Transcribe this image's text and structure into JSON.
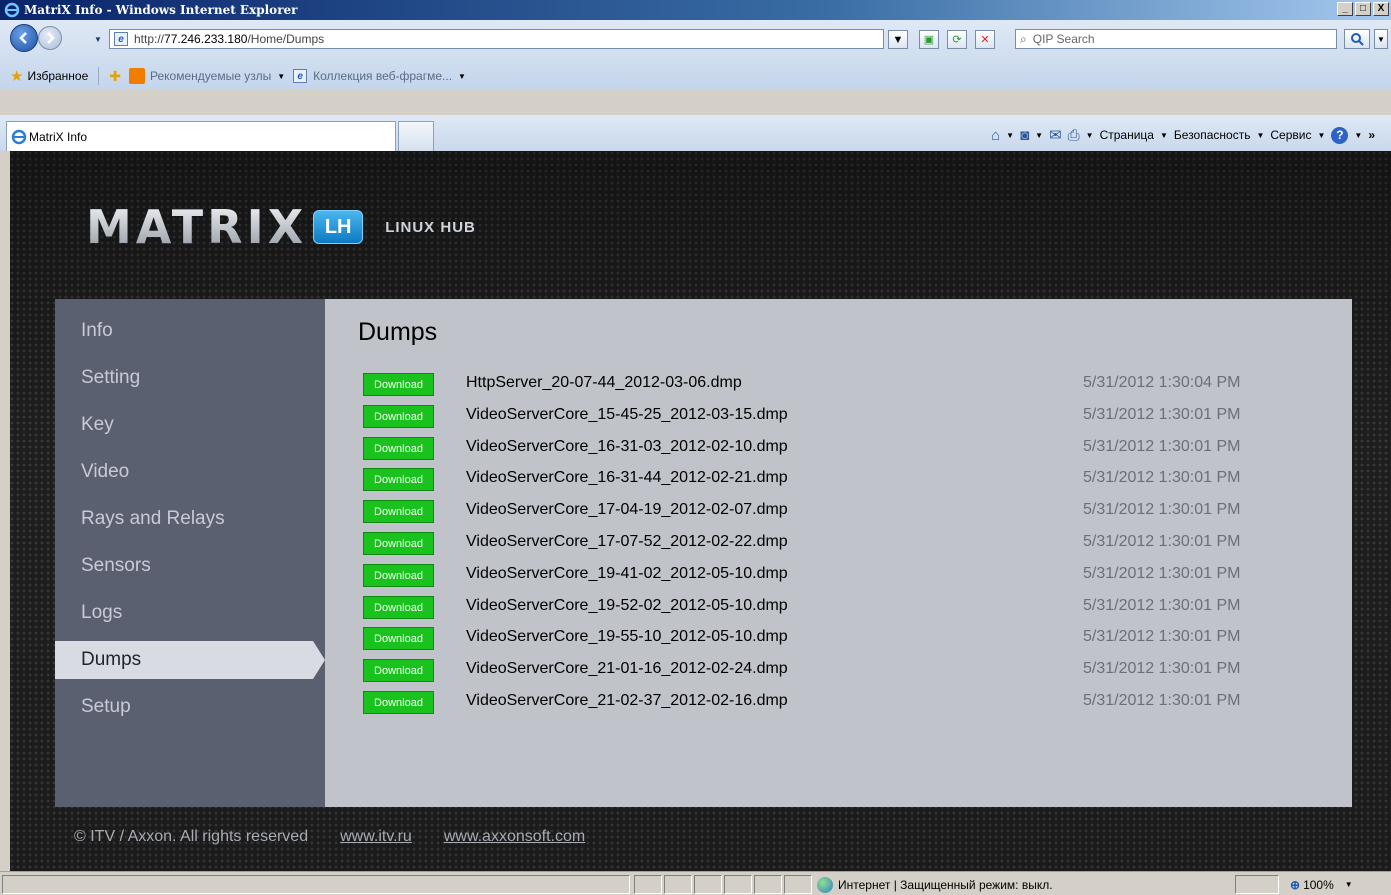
{
  "window": {
    "title": "MatriX Info - Windows Internet Explorer",
    "minimize": "_",
    "maximize": "□",
    "close": "X"
  },
  "address": {
    "url_prefix": "http://",
    "url_host": "77.246.233.180",
    "url_path": "/Home/Dumps",
    "search_placeholder": "QIP Search"
  },
  "favorites": {
    "label": "Избранное",
    "recommended": "Рекомендуемые узлы",
    "collection": "Коллекция веб-фрагме..."
  },
  "tab": {
    "title": "MatriX Info"
  },
  "commandbar": {
    "page": "Страница",
    "safety": "Безопасность",
    "tools": "Сервис",
    "more": "»"
  },
  "brand": {
    "word": "MATRIX",
    "badge": "LH",
    "subtitle": "LINUX HUB"
  },
  "nav": {
    "items": [
      {
        "label": "Info"
      },
      {
        "label": "Setting"
      },
      {
        "label": "Key"
      },
      {
        "label": "Video"
      },
      {
        "label": "Rays and Relays"
      },
      {
        "label": "Sensors"
      },
      {
        "label": "Logs"
      },
      {
        "label": "Dumps"
      },
      {
        "label": "Setup"
      }
    ],
    "active": "Dumps"
  },
  "page": {
    "title": "Dumps",
    "download_label": "Download",
    "files": [
      {
        "name": "HttpServer_20-07-44_2012-03-06.dmp",
        "date": "5/31/2012 1:30:04 PM"
      },
      {
        "name": "VideoServerCore_15-45-25_2012-03-15.dmp",
        "date": "5/31/2012 1:30:01 PM"
      },
      {
        "name": "VideoServerCore_16-31-03_2012-02-10.dmp",
        "date": "5/31/2012 1:30:01 PM"
      },
      {
        "name": "VideoServerCore_16-31-44_2012-02-21.dmp",
        "date": "5/31/2012 1:30:01 PM"
      },
      {
        "name": "VideoServerCore_17-04-19_2012-02-07.dmp",
        "date": "5/31/2012 1:30:01 PM"
      },
      {
        "name": "VideoServerCore_17-07-52_2012-02-22.dmp",
        "date": "5/31/2012 1:30:01 PM"
      },
      {
        "name": "VideoServerCore_19-41-02_2012-05-10.dmp",
        "date": "5/31/2012 1:30:01 PM"
      },
      {
        "name": "VideoServerCore_19-52-02_2012-05-10.dmp",
        "date": "5/31/2012 1:30:01 PM"
      },
      {
        "name": "VideoServerCore_19-55-10_2012-05-10.dmp",
        "date": "5/31/2012 1:30:01 PM"
      },
      {
        "name": "VideoServerCore_21-01-16_2012-02-24.dmp",
        "date": "5/31/2012 1:30:01 PM"
      },
      {
        "name": "VideoServerCore_21-02-37_2012-02-16.dmp",
        "date": "5/31/2012 1:30:01 PM"
      }
    ]
  },
  "footer": {
    "copyright": "© ITV / Axxon. All rights reserved",
    "link1": "www.itv.ru",
    "link2": "www.axxonsoft.com"
  },
  "status": {
    "zone": "Интернет | Защищенный режим: выкл.",
    "zoom": "100%"
  }
}
